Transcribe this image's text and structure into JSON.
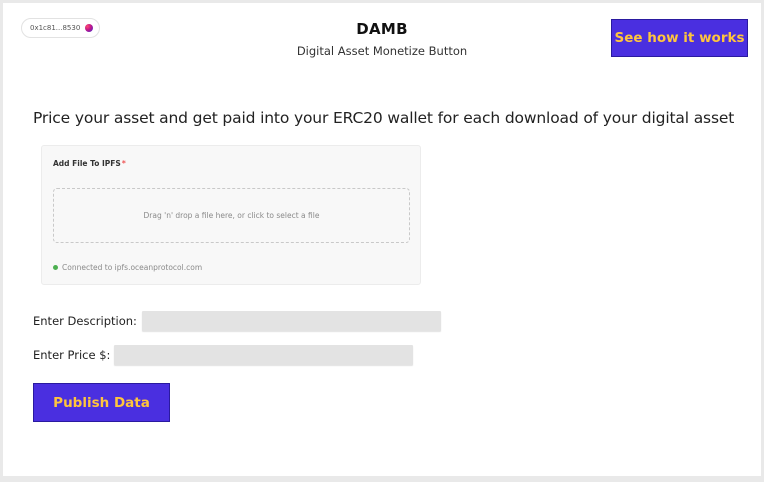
{
  "header": {
    "wallet_address": "0x1c81...8530",
    "title": "DAMB",
    "subtitle": "Digital Asset Monetize Button",
    "how_button_label": "See how it works"
  },
  "main": {
    "headline": "Price your asset and get paid into your ERC20 wallet for each download of your digital asset",
    "upload": {
      "label": "Add File To IPFS",
      "required_marker": "*",
      "dropzone_text": "Drag 'n' drop a file here, or click to select a file",
      "status_text": "Connected to ipfs.oceanprotocol.com"
    },
    "description_label": "Enter Description:",
    "description_value": "",
    "price_label": "Enter Price $:",
    "price_value": "",
    "publish_button_label": "Publish Data"
  },
  "colors": {
    "accent_button": "#4a2fe0",
    "button_text": "#ffc53d",
    "status_connected": "#4caf50"
  }
}
